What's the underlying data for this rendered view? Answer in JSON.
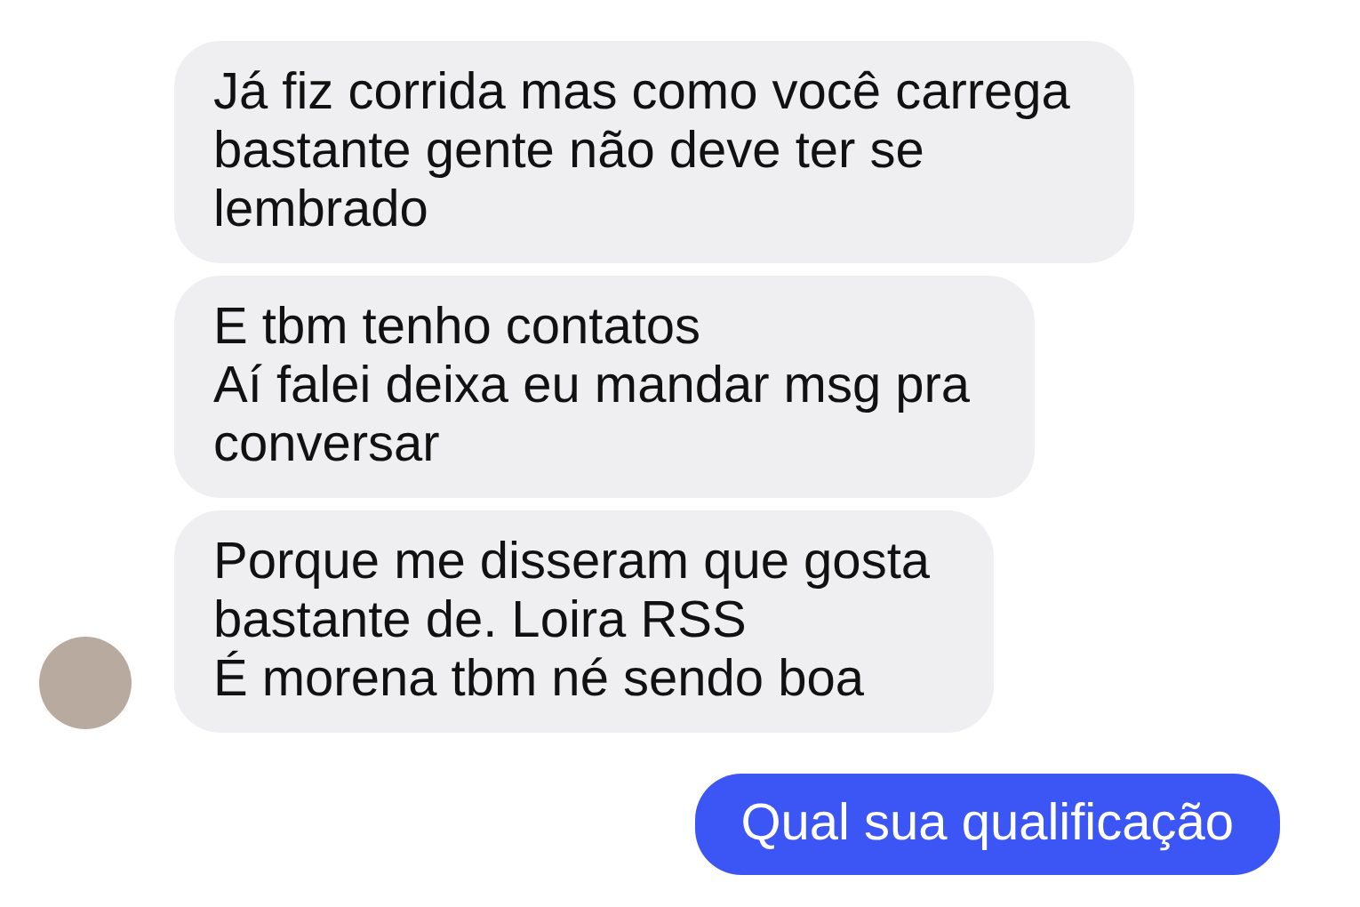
{
  "messages": [
    {
      "kind": "received",
      "text": "Já fiz corrida mas como você carrega\nbastante gente não deve ter se\nlembrado",
      "avatar": false
    },
    {
      "kind": "received",
      "text": "E tbm tenho contatos\nAí falei deixa eu mandar msg pra\nconversar",
      "avatar": false
    },
    {
      "kind": "received",
      "text": "Porque me disseram que gosta\nbastante de. Loira RSS\nÉ morena tbm né sendo boa",
      "avatar": true
    },
    {
      "kind": "sent",
      "text": "Qual sua qualificação",
      "avatar": false
    }
  ]
}
